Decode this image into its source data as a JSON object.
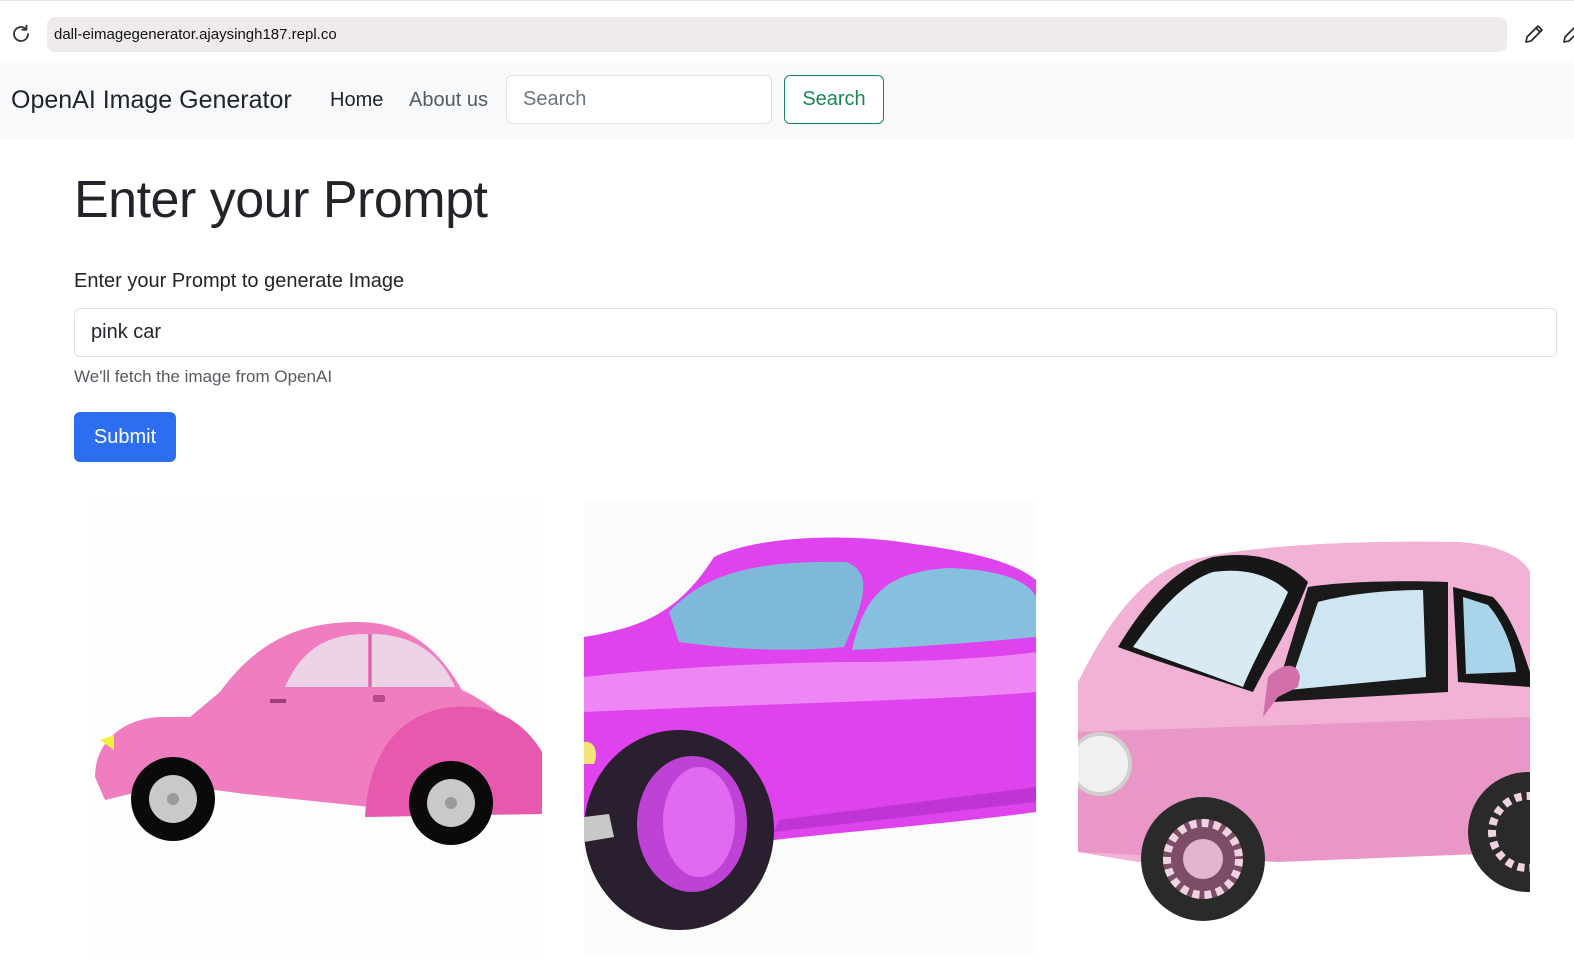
{
  "browser": {
    "url": "dall-eimagegenerator.ajaysingh187.repl.co",
    "icons": [
      "reload-icon",
      "pencil-icon",
      "pencil-icon"
    ]
  },
  "navbar": {
    "brand": "OpenAI Image Generator",
    "links": [
      "Home",
      "About us"
    ],
    "search": {
      "placeholder": "Search",
      "button_label": "Search"
    }
  },
  "main": {
    "title": "Enter your Prompt",
    "prompt_label": "Enter your Prompt to generate Image",
    "prompt_value": "pink car",
    "help_text": "We'll fetch the image from OpenAI",
    "submit_label": "Submit",
    "images": [
      "pink beetle car",
      "magenta sports car",
      "pink compact car"
    ]
  },
  "colors": {
    "primary": "#2d6ef0",
    "success": "#198754",
    "navbar_bg": "#f8f9fa"
  }
}
